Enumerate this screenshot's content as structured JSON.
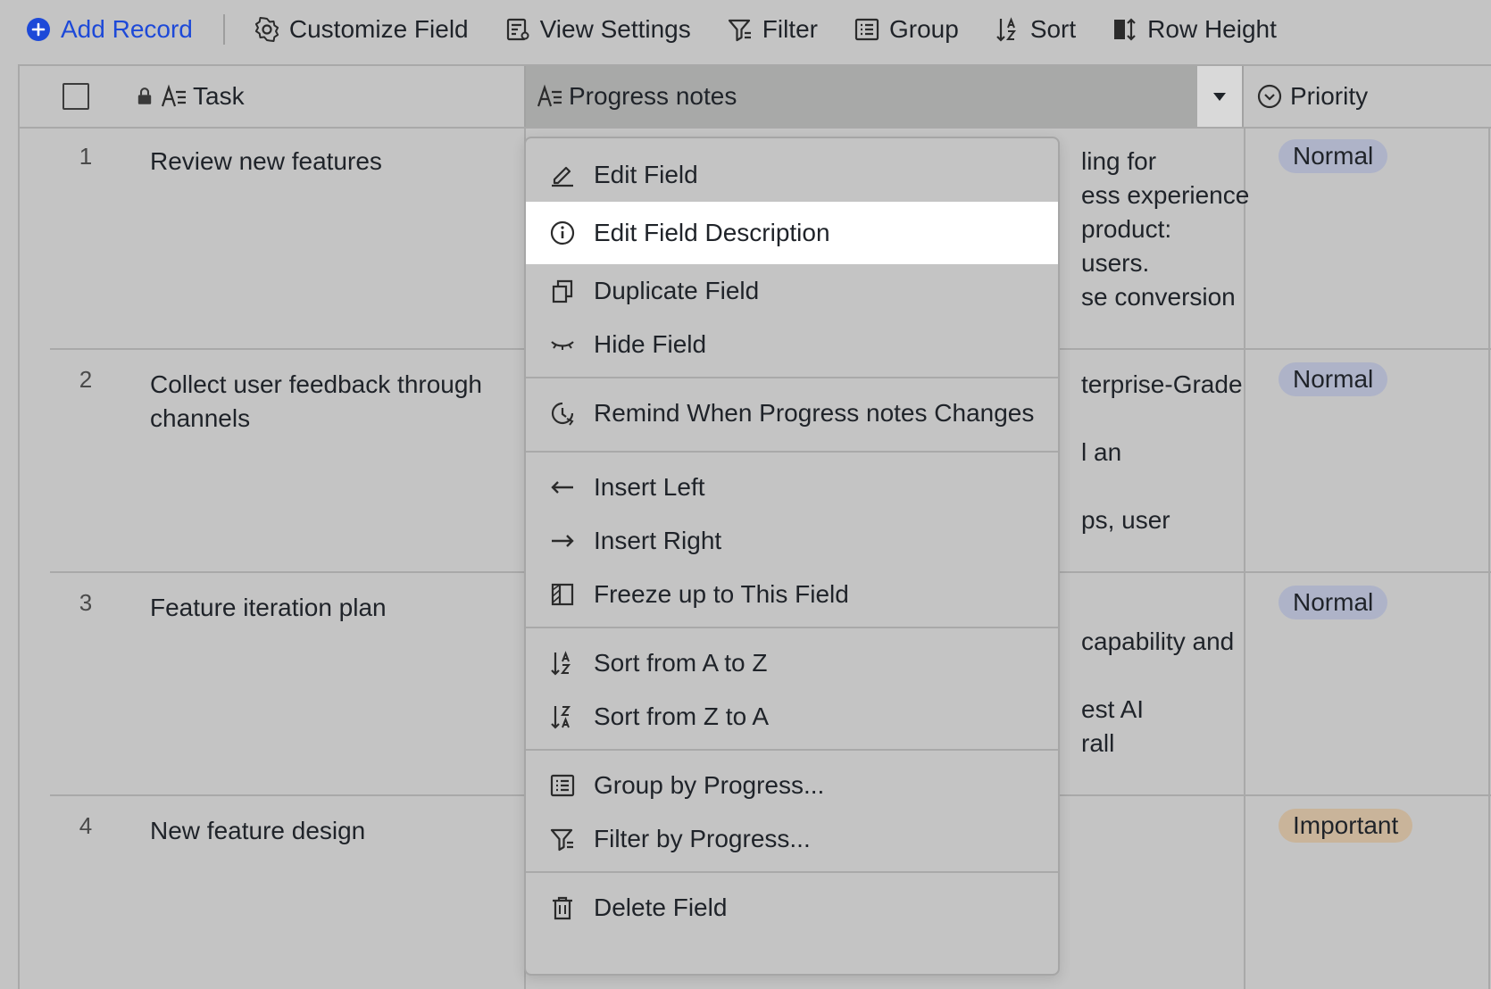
{
  "toolbar": {
    "add_record": "Add Record",
    "customize_field": "Customize Field",
    "view_settings": "View Settings",
    "filter": "Filter",
    "group": "Group",
    "sort": "Sort",
    "row_height": "Row Height"
  },
  "columns": {
    "task": "Task",
    "progress_notes": "Progress notes",
    "priority": "Priority"
  },
  "rows": [
    {
      "num": "1",
      "task": "Review new features",
      "notes": [
        "ling for",
        "ess experience",
        "product:",
        "users.",
        "se conversion"
      ],
      "priority": "Normal"
    },
    {
      "num": "2",
      "task": "Collect user feedback through channels",
      "notes": [
        "terprise-Grade",
        "",
        "l an",
        "",
        "ps, user"
      ],
      "priority": "Normal"
    },
    {
      "num": "3",
      "task": "Feature iteration plan",
      "notes": [
        "",
        "capability and",
        "",
        "est AI",
        "rall"
      ],
      "priority": "Normal"
    },
    {
      "num": "4",
      "task": "New feature design",
      "notes": [],
      "priority": "Important"
    }
  ],
  "menu": {
    "edit_field": "Edit Field",
    "edit_field_description": "Edit Field Description",
    "duplicate_field": "Duplicate Field",
    "hide_field": "Hide Field",
    "remind": "Remind When Progress notes Changes",
    "insert_left": "Insert Left",
    "insert_right": "Insert Right",
    "freeze": "Freeze up to This Field",
    "sort_az": "Sort from A to Z",
    "sort_za": "Sort from Z to A",
    "group_by": "Group by  Progress...",
    "filter_by": "Filter by  Progress...",
    "delete_field": "Delete Field"
  },
  "colors": {
    "accent": "#1d49d8",
    "normal_badge": "#aeb3c8",
    "important_badge": "#c9b49a",
    "menu_highlight": "#ffffff"
  }
}
